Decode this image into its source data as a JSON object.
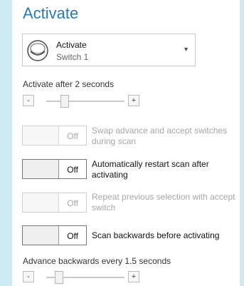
{
  "window": {
    "title": "Activate"
  },
  "switch": {
    "name": "Activate",
    "subtitle": "Switch 1"
  },
  "activate_after": {
    "label": "Activate after 2 seconds",
    "minus": "-",
    "plus": "+",
    "level": 0.2
  },
  "options": [
    {
      "state": "Off",
      "text": "Swap advance and accept switches during scan",
      "enabled": false
    },
    {
      "state": "Off",
      "text": "Automatically restart scan after activating",
      "enabled": true
    },
    {
      "state": "Off",
      "text": "Repeat previous selection with accept switch",
      "enabled": false
    },
    {
      "state": "Off",
      "text": "Scan backwards before activating",
      "enabled": true
    }
  ],
  "advance_backwards": {
    "label": "Advance backwards every 1.5 seconds",
    "minus": "-",
    "plus": "+",
    "level": 0.12
  },
  "colors": {
    "accent": "#2a79b5",
    "background": "#cfeaf3",
    "panel": "#ffffff"
  }
}
